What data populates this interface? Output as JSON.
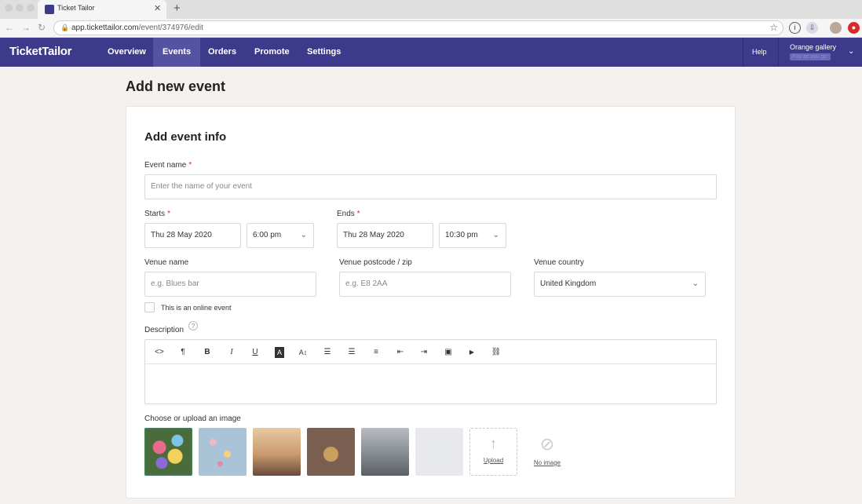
{
  "browser": {
    "tab_title": "Ticket Tailor",
    "url_host": "app.tickettailor.com",
    "url_path": "/event/374976/edit"
  },
  "app": {
    "logo": "TicketTailor",
    "nav": [
      "Overview",
      "Events",
      "Orders",
      "Promote",
      "Settings"
    ],
    "active_nav": "Events",
    "help": "Help",
    "account_name": "Orange gallery",
    "account_plan": "Pay as you go"
  },
  "page": {
    "title": "Add new event",
    "section_title": "Add event info"
  },
  "form": {
    "event_name_label": "Event name",
    "event_name_placeholder": "Enter the name of your event",
    "starts_label": "Starts",
    "start_date": "Thu 28 May 2020",
    "start_time": "6:00 pm",
    "ends_label": "Ends",
    "end_date": "Thu 28 May 2020",
    "end_time": "10:30 pm",
    "venue_name_label": "Venue name",
    "venue_name_placeholder": "e.g. Blues bar",
    "venue_postcode_label": "Venue postcode / zip",
    "venue_postcode_placeholder": "e.g. E8 2AA",
    "venue_country_label": "Venue country",
    "venue_country": "United Kingdom",
    "online_label": "This is an online event",
    "description_label": "Description",
    "required_mark": "*",
    "help_mark": "?"
  },
  "toolbar": [
    "<>",
    "¶",
    "B",
    "I",
    "U",
    "A",
    "A↕",
    "☰",
    "☰",
    "≡",
    "⇤",
    "⇥",
    "▣",
    "▶",
    "⛓"
  ],
  "images": {
    "label": "Choose or upload an image",
    "upload": "Upload",
    "no_image": "No image",
    "thumb_colors": [
      "#4a6b3a",
      "#a8c4d6",
      "#c99b6e",
      "#7a5f50",
      "#8a8f96",
      "#e8e9ec"
    ]
  }
}
